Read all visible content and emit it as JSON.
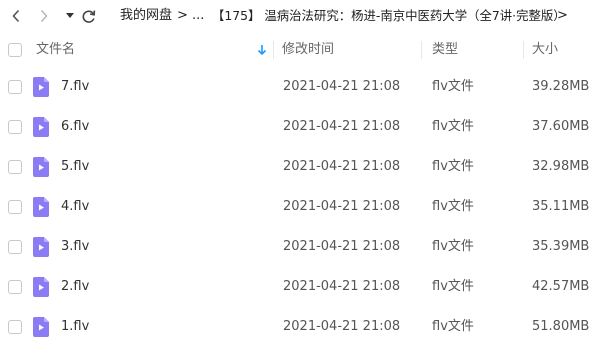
{
  "toolbar": {
    "back_icon": "chevron-left-icon",
    "forward_icon": "chevron-right-icon",
    "dropdown_icon": "triangle-down-icon",
    "refresh_icon": "refresh-icon",
    "breadcrumb": {
      "root": "我的网盘",
      "ellipsis": "...",
      "current": "【175】 温病治法研究：杨进-南京中医药大学（全7讲·完整版）",
      "separator": ">"
    }
  },
  "columns": {
    "name": "文件名",
    "modified": "修改时间",
    "type": "类型",
    "size": "大小",
    "sort_icon": "arrow-down-icon"
  },
  "colors": {
    "file_icon": "#8b7cf6",
    "sort_arrow": "#1e9bff"
  },
  "files": [
    {
      "name": "7.flv",
      "modified": "2021-04-21 21:08",
      "type": "flv文件",
      "size": "39.28MB"
    },
    {
      "name": "6.flv",
      "modified": "2021-04-21 21:08",
      "type": "flv文件",
      "size": "37.60MB"
    },
    {
      "name": "5.flv",
      "modified": "2021-04-21 21:08",
      "type": "flv文件",
      "size": "32.98MB"
    },
    {
      "name": "4.flv",
      "modified": "2021-04-21 21:08",
      "type": "flv文件",
      "size": "35.11MB"
    },
    {
      "name": "3.flv",
      "modified": "2021-04-21 21:08",
      "type": "flv文件",
      "size": "35.39MB"
    },
    {
      "name": "2.flv",
      "modified": "2021-04-21 21:08",
      "type": "flv文件",
      "size": "42.57MB"
    },
    {
      "name": "1.flv",
      "modified": "2021-04-21 21:08",
      "type": "flv文件",
      "size": "51.80MB"
    }
  ]
}
